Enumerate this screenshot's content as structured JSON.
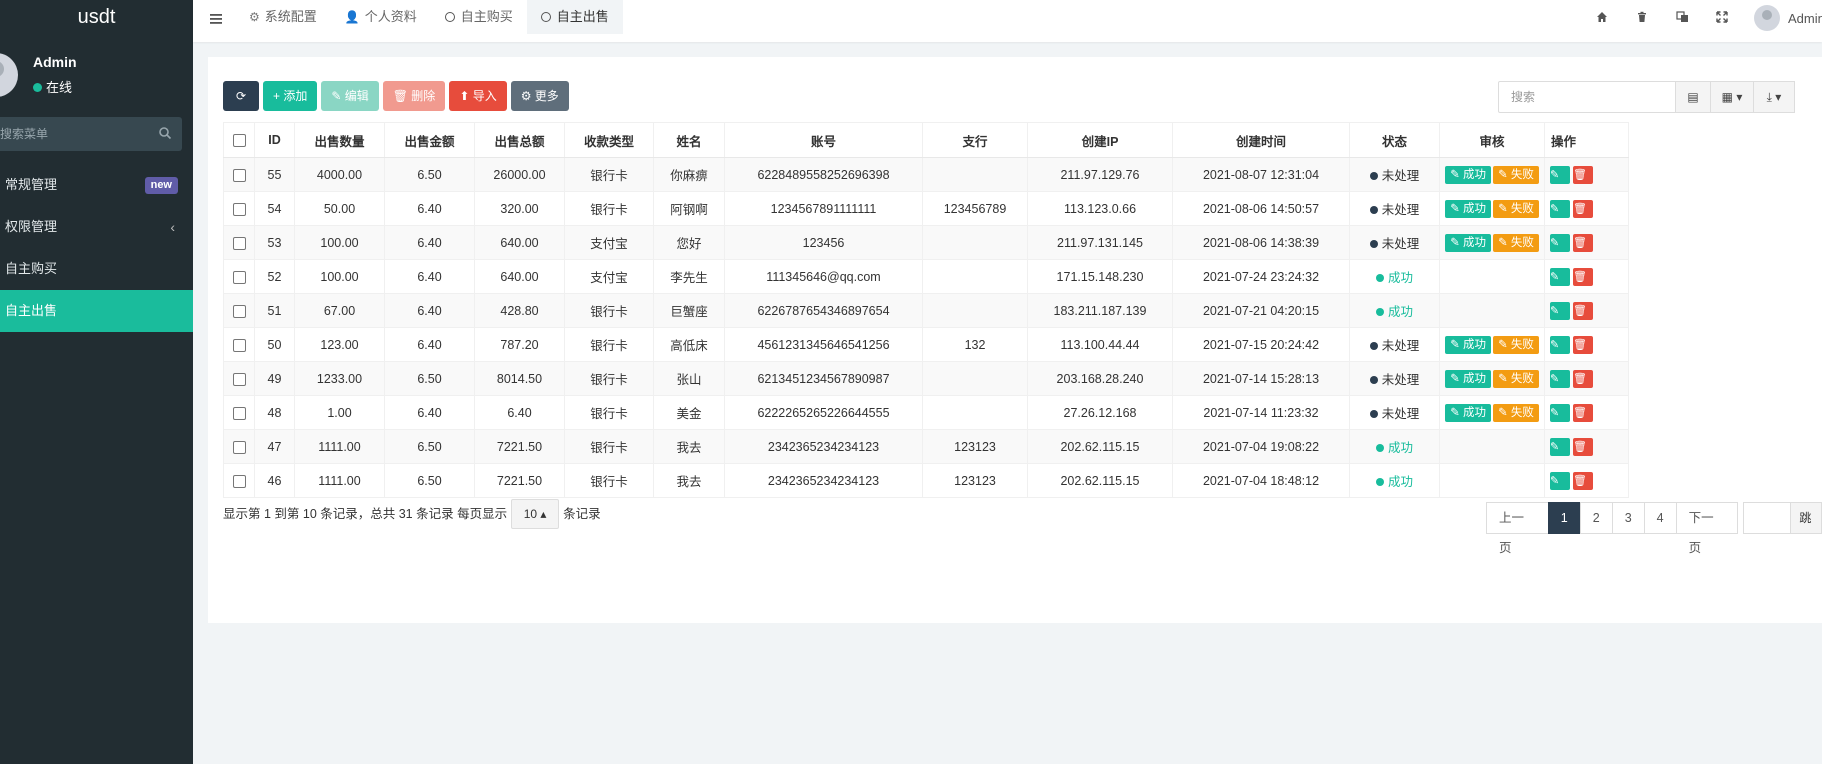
{
  "app": {
    "title": "usdt"
  },
  "user": {
    "name": "Admin",
    "status": "在线"
  },
  "sidebar": {
    "search_placeholder": "搜索菜单",
    "items": [
      {
        "label": "常规管理",
        "badge": "new"
      },
      {
        "label": "权限管理",
        "chevron": "‹"
      },
      {
        "label": "自主购买"
      },
      {
        "label": "自主出售"
      }
    ]
  },
  "topbar": {
    "tabs": [
      {
        "label": "系统配置",
        "icon": "⚙"
      },
      {
        "label": "个人资料",
        "icon": "👤"
      },
      {
        "label": "自主购买"
      },
      {
        "label": "自主出售"
      }
    ],
    "user_name": "Admin"
  },
  "toolbar": {
    "refresh_icon": "⟳",
    "add": "+ 添加",
    "edit": "✎ 编辑",
    "delete": "🗑 删除",
    "import": "⬆ 导入",
    "more": "⚙ 更多",
    "search_placeholder": "搜索",
    "view_toggle_icon": "▤",
    "columns_icon": "▦ ▾",
    "export_icon": "⤓ ▾"
  },
  "table": {
    "headers": [
      "ID",
      "出售数量",
      "出售金额",
      "出售总额",
      "收款类型",
      "姓名",
      "账号",
      "支行",
      "创建IP",
      "创建时间",
      "状态",
      "审核",
      "操作"
    ],
    "rows": [
      {
        "id": "55",
        "qty": "4000.00",
        "price": "6.50",
        "total": "26000.00",
        "paytype": "银行卡",
        "name": "你麻痹",
        "account": "6228489558252696398",
        "branch": "",
        "ip": "211.97.129.76",
        "time": "2021-08-07 12:31:04",
        "status": "未处理"
      },
      {
        "id": "54",
        "qty": "50.00",
        "price": "6.40",
        "total": "320.00",
        "paytype": "银行卡",
        "name": "阿钢啊",
        "account": "1234567891111111",
        "branch": "123456789",
        "ip": "113.123.0.66",
        "time": "2021-08-06 14:50:57",
        "status": "未处理"
      },
      {
        "id": "53",
        "qty": "100.00",
        "price": "6.40",
        "total": "640.00",
        "paytype": "支付宝",
        "name": "您好",
        "account": "123456",
        "branch": "",
        "ip": "211.97.131.145",
        "time": "2021-08-06 14:38:39",
        "status": "未处理"
      },
      {
        "id": "52",
        "qty": "100.00",
        "price": "6.40",
        "total": "640.00",
        "paytype": "支付宝",
        "name": "李先生",
        "account": "111345646@qq.com",
        "branch": "",
        "ip": "171.15.148.230",
        "time": "2021-07-24 23:24:32",
        "status": "成功"
      },
      {
        "id": "51",
        "qty": "67.00",
        "price": "6.40",
        "total": "428.80",
        "paytype": "银行卡",
        "name": "巨蟹座",
        "account": "6226787654346897654",
        "branch": "",
        "ip": "183.211.187.139",
        "time": "2021-07-21 04:20:15",
        "status": "成功"
      },
      {
        "id": "50",
        "qty": "123.00",
        "price": "6.40",
        "total": "787.20",
        "paytype": "银行卡",
        "name": "高低床",
        "account": "4561231345646541256",
        "branch": "132",
        "ip": "113.100.44.44",
        "time": "2021-07-15 20:24:42",
        "status": "未处理"
      },
      {
        "id": "49",
        "qty": "1233.00",
        "price": "6.50",
        "total": "8014.50",
        "paytype": "银行卡",
        "name": "张山",
        "account": "6213451234567890987",
        "branch": "",
        "ip": "203.168.28.240",
        "time": "2021-07-14 15:28:13",
        "status": "未处理"
      },
      {
        "id": "48",
        "qty": "1.00",
        "price": "6.40",
        "total": "6.40",
        "paytype": "银行卡",
        "name": "美金",
        "account": "6222265265226644555",
        "branch": "",
        "ip": "27.26.12.168",
        "time": "2021-07-14 11:23:32",
        "status": "未处理"
      },
      {
        "id": "47",
        "qty": "1111.00",
        "price": "6.50",
        "total": "7221.50",
        "paytype": "银行卡",
        "name": "我去",
        "account": "2342365234234123",
        "branch": "123123",
        "ip": "202.62.115.15",
        "time": "2021-07-04 19:08:22",
        "status": "成功"
      },
      {
        "id": "46",
        "qty": "1111.00",
        "price": "6.50",
        "total": "7221.50",
        "paytype": "银行卡",
        "name": "我去",
        "account": "2342365234234123",
        "branch": "123123",
        "ip": "202.62.115.15",
        "time": "2021-07-04 18:48:12",
        "status": "成功"
      }
    ],
    "audit_success": "✎ 成功",
    "audit_fail": "✎ 失败",
    "edit_icon": "✎",
    "delete_icon": "🗑"
  },
  "pagination": {
    "info": "显示第 1 到第 10 条记录，总共 31 条记录 每页显示",
    "page_size": "10 ▴",
    "suffix": "条记录",
    "prev": "上一页",
    "pages": [
      "1",
      "2",
      "3",
      "4"
    ],
    "next": "下一页",
    "jump": "跳转"
  },
  "colors": {
    "accent": "#18bc9c",
    "sidebar": "#222d32",
    "dark": "#2c3e50",
    "danger": "#e74c3c",
    "warning": "#f39c12"
  }
}
